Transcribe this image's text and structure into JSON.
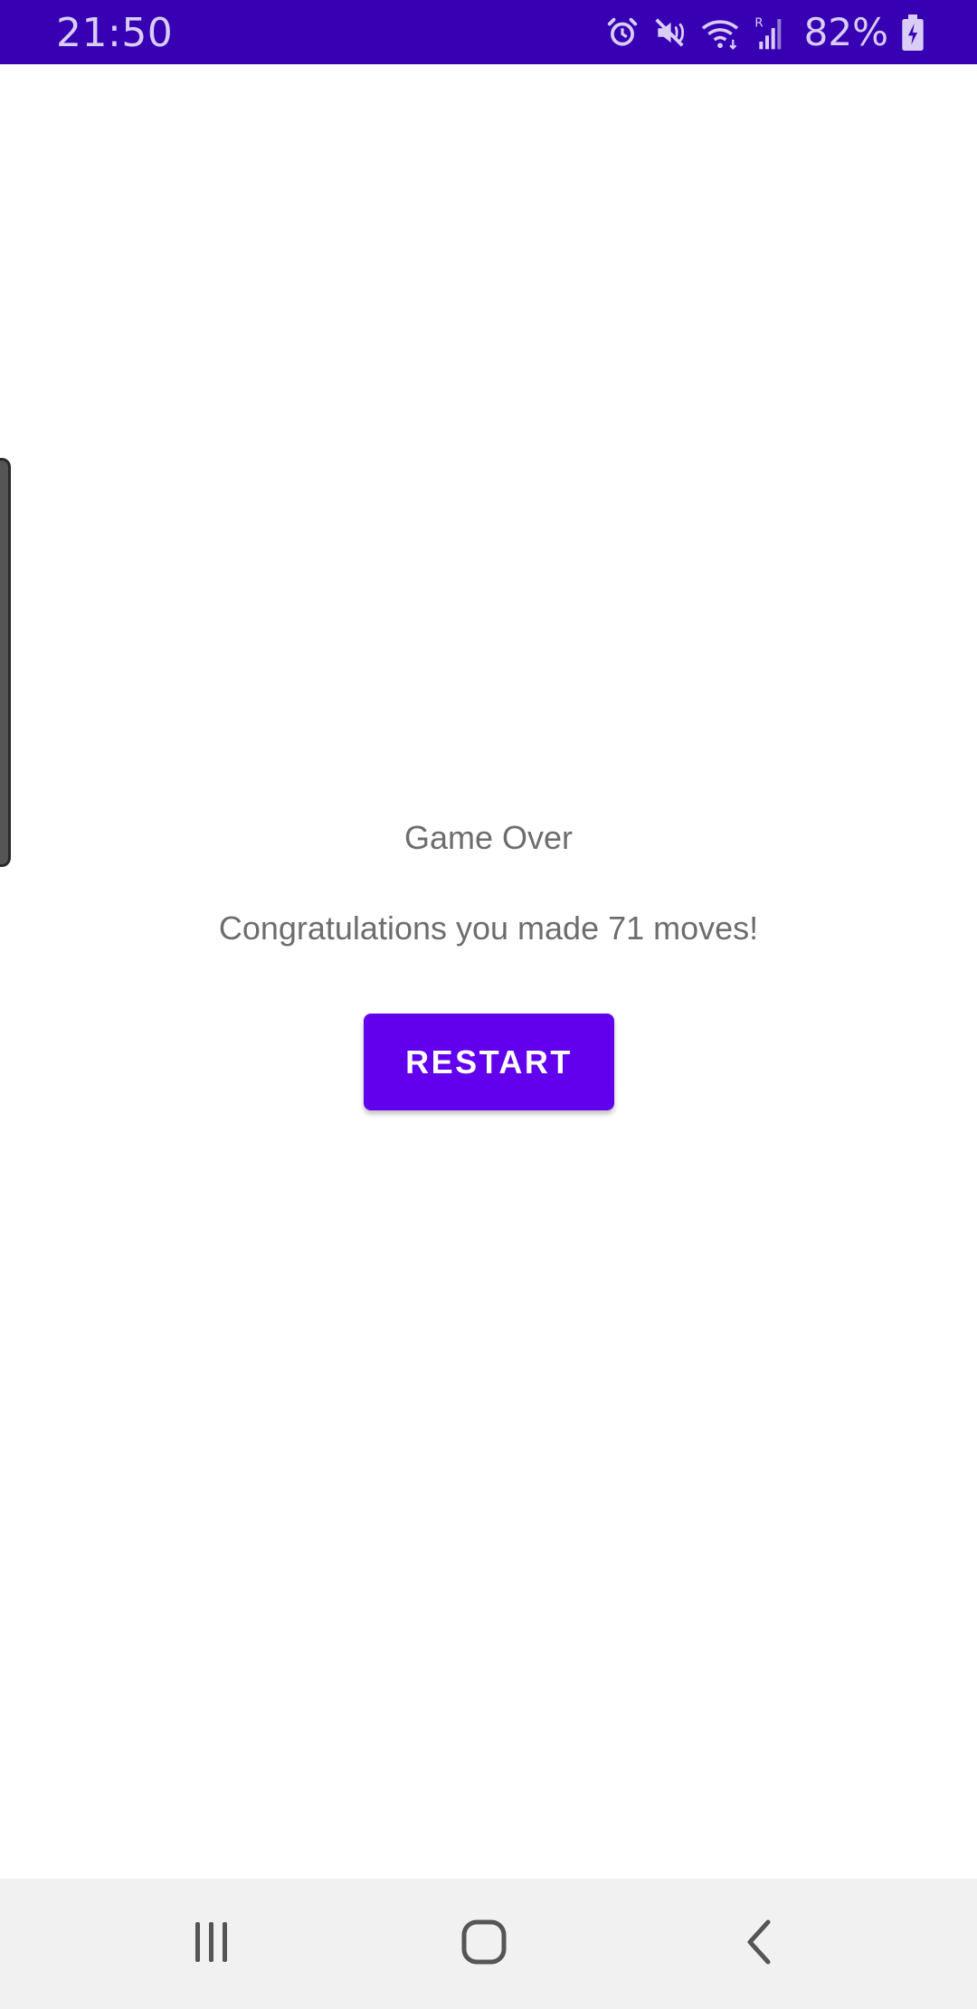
{
  "status_bar": {
    "time": "21:50",
    "battery": "82%",
    "background": "#3700b3",
    "icons": [
      "alarm-icon",
      "mute-icon",
      "wifi-icon",
      "signal-icon",
      "battery-charging-icon"
    ]
  },
  "screen": {
    "title": "Game Over",
    "message": "Congratulations you made 71 moves!",
    "restart_label": "RESTART",
    "accent_color": "#6200ee"
  },
  "nav_bar": {
    "icons": [
      "recent-apps-icon",
      "home-icon",
      "back-icon"
    ]
  }
}
